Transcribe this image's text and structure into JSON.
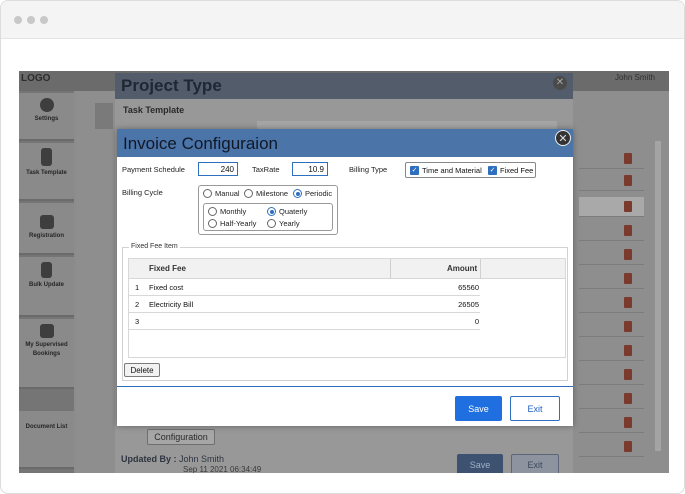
{
  "app": {
    "logo_text": "LOGO",
    "user_name": "John Smith",
    "sidebar": [
      {
        "label": "Settings"
      },
      {
        "label": "Task Template"
      },
      {
        "label": "Registration"
      },
      {
        "label": "Bulk Update"
      },
      {
        "label": "My Supervised Bookings"
      },
      {
        "label": "Document List"
      }
    ]
  },
  "project_type": {
    "title": "Project Type",
    "subtitle": "Task Template",
    "config_button": "Configuration",
    "updated_by_label": "Updated By :",
    "updated_by_value": "John Smith",
    "updated_date": "Sep 11 2021 06:34:49",
    "save_label": "Save",
    "exit_label": "Exit"
  },
  "invoice": {
    "title": "Invoice Configuraion",
    "payment_schedule_label": "Payment Schedule",
    "payment_schedule_value": "240",
    "taxrate_label": "TaxRate",
    "taxrate_value": "10.9",
    "billing_type_label": "Billing Type",
    "billing_type_options": [
      "Time and Material",
      "Fixed Fee"
    ],
    "billing_cycle_label": "Billing Cycle",
    "billing_cycle_options": [
      "Manual",
      "Milestone",
      "Periodic"
    ],
    "billing_cycle_selected": "Periodic",
    "period_options": [
      "Monthly",
      "Quaterly",
      "Half-Yearly",
      "Yearly"
    ],
    "period_selected": "Quaterly",
    "fixed_fee_legend": "Fixed Fee Item",
    "columns": [
      "Fixed Fee",
      "Amount"
    ],
    "rows": [
      {
        "num": "1",
        "name": "Fixed cost",
        "amount": "65560"
      },
      {
        "num": "2",
        "name": "Electricity Bill",
        "amount": "26505"
      },
      {
        "num": "3",
        "name": "",
        "amount": "0"
      }
    ],
    "delete_label": "Delete",
    "save_label": "Save",
    "exit_label": "Exit",
    "close_glyph": "✕"
  },
  "colors": {
    "accent": "#1f6fe0",
    "header_blue": "#4b74a8"
  }
}
